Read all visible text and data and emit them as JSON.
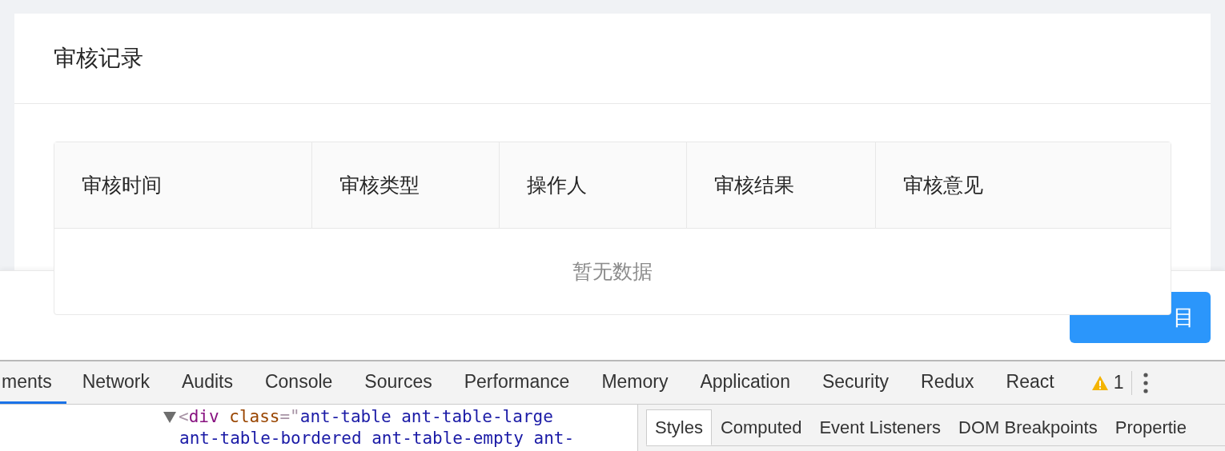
{
  "card": {
    "title": "审核记录"
  },
  "table": {
    "columns": [
      "审核时间",
      "审核类型",
      "操作人",
      "审核结果",
      "审核意见"
    ],
    "empty_text": "暂无数据"
  },
  "footer": {
    "button": "目"
  },
  "devtools": {
    "tabs": [
      {
        "label": "ments",
        "selected": true
      },
      {
        "label": "Network",
        "selected": false
      },
      {
        "label": "Audits",
        "selected": false
      },
      {
        "label": "Console",
        "selected": false
      },
      {
        "label": "Sources",
        "selected": false
      },
      {
        "label": "Performance",
        "selected": false
      },
      {
        "label": "Memory",
        "selected": false
      },
      {
        "label": "Application",
        "selected": false
      },
      {
        "label": "Security",
        "selected": false
      },
      {
        "label": "Redux",
        "selected": false
      },
      {
        "label": "React",
        "selected": false
      }
    ],
    "warning_count": "1",
    "code": {
      "expanded": true,
      "open_bracket": "<",
      "tag": "div",
      "attr": "class",
      "equals_quote": "=\"",
      "value_lines": [
        "ant-table ant-table-large",
        "ant-table-bordered ant-table-empty ant-"
      ]
    },
    "sidebar_tabs": [
      {
        "label": "Styles",
        "selected": true
      },
      {
        "label": "Computed",
        "selected": false
      },
      {
        "label": "Event Listeners",
        "selected": false
      },
      {
        "label": "DOM Breakpoints",
        "selected": false
      },
      {
        "label": "Propertie",
        "selected": false
      }
    ]
  }
}
